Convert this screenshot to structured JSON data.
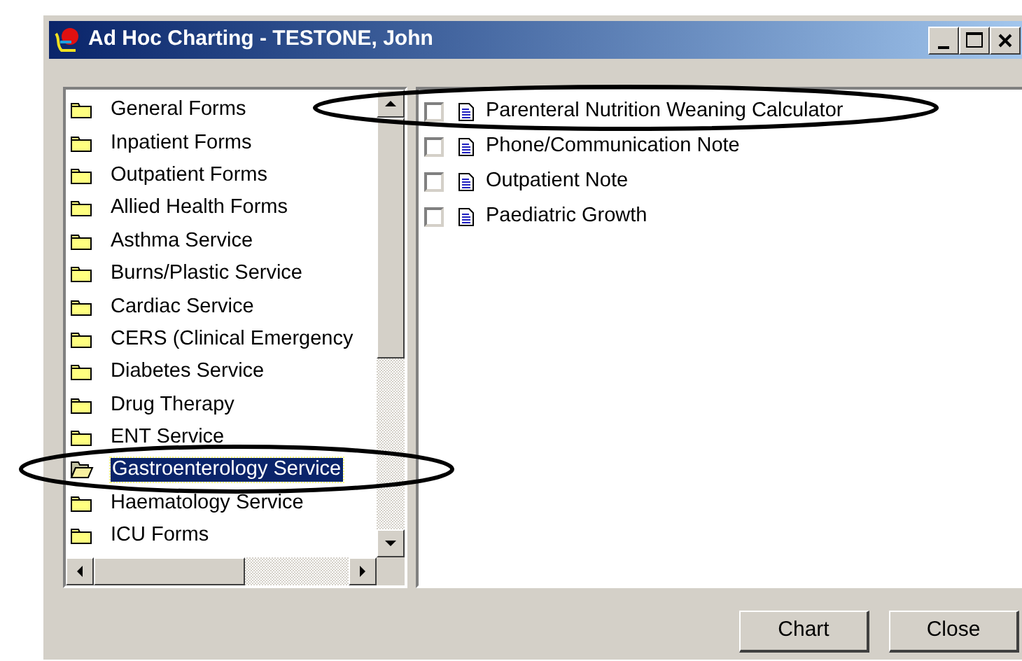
{
  "window": {
    "title": "Ad Hoc Charting - TESTONE, John"
  },
  "folders": [
    {
      "label": "General Forms",
      "selected": false,
      "circled": false
    },
    {
      "label": "Inpatient Forms",
      "selected": false,
      "circled": false
    },
    {
      "label": "Outpatient Forms",
      "selected": false,
      "circled": false
    },
    {
      "label": "Allied Health Forms",
      "selected": false,
      "circled": false
    },
    {
      "label": "Asthma Service",
      "selected": false,
      "circled": false
    },
    {
      "label": "Burns/Plastic Service",
      "selected": false,
      "circled": false
    },
    {
      "label": "Cardiac Service",
      "selected": false,
      "circled": false
    },
    {
      "label": "CERS (Clinical Emergency",
      "selected": false,
      "circled": false
    },
    {
      "label": "Diabetes Service",
      "selected": false,
      "circled": false
    },
    {
      "label": "Drug Therapy",
      "selected": false,
      "circled": false
    },
    {
      "label": "ENT Service",
      "selected": false,
      "circled": false
    },
    {
      "label": "Gastroenterology Service",
      "selected": true,
      "circled": true
    },
    {
      "label": "Haematology Service",
      "selected": false,
      "circled": false
    },
    {
      "label": "ICU Forms",
      "selected": false,
      "circled": false
    }
  ],
  "forms": [
    {
      "label": "Parenteral Nutrition Weaning Calculator",
      "checked": false,
      "circled": true
    },
    {
      "label": "Phone/Communication Note",
      "checked": false,
      "circled": false
    },
    {
      "label": "Outpatient Note",
      "checked": false,
      "circled": false
    },
    {
      "label": "Paediatric Growth",
      "checked": false,
      "circled": false
    }
  ],
  "buttons": [
    "Chart",
    "Close"
  ]
}
